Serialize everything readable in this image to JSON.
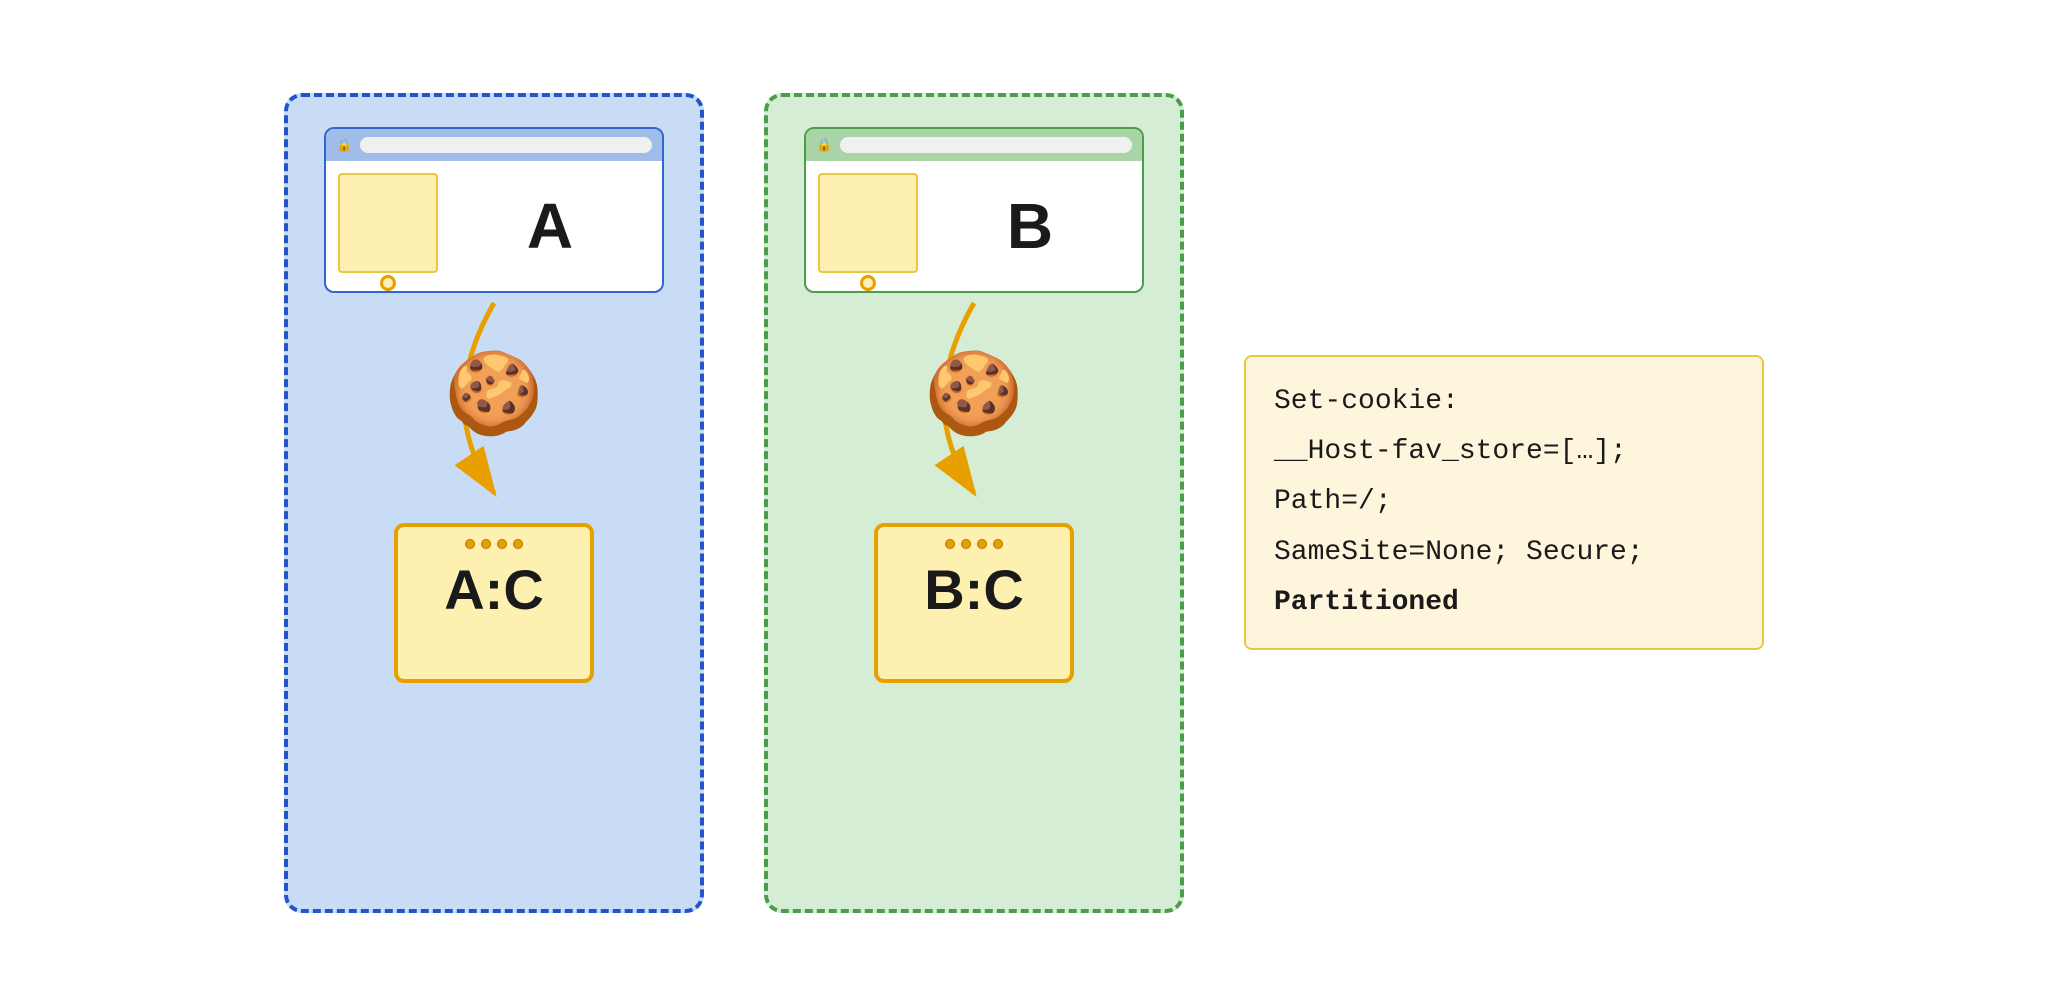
{
  "partitions": [
    {
      "id": "partition-a",
      "color": "blue",
      "browser_label": "A",
      "storage_label": "A:C",
      "cookie_emoji": "🍪"
    },
    {
      "id": "partition-b",
      "color": "green",
      "browser_label": "B",
      "storage_label": "B:C",
      "cookie_emoji": "🍪"
    }
  ],
  "cookie_header": {
    "lines": [
      "Set-cookie:",
      "__Host-fav_store=[…];",
      "Path=/;",
      "SameSite=None; Secure;",
      "Partitioned"
    ],
    "bold_line": "Partitioned"
  }
}
